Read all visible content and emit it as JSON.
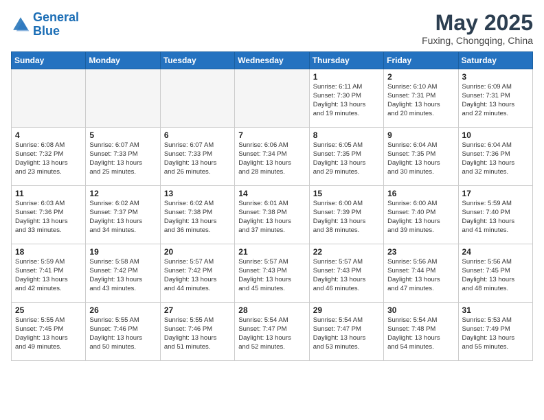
{
  "logo": {
    "line1": "General",
    "line2": "Blue"
  },
  "title": "May 2025",
  "subtitle": "Fuxing, Chongqing, China",
  "days_of_week": [
    "Sunday",
    "Monday",
    "Tuesday",
    "Wednesday",
    "Thursday",
    "Friday",
    "Saturday"
  ],
  "weeks": [
    [
      {
        "day": "",
        "info": ""
      },
      {
        "day": "",
        "info": ""
      },
      {
        "day": "",
        "info": ""
      },
      {
        "day": "",
        "info": ""
      },
      {
        "day": "1",
        "info": "Sunrise: 6:11 AM\nSunset: 7:30 PM\nDaylight: 13 hours\nand 19 minutes."
      },
      {
        "day": "2",
        "info": "Sunrise: 6:10 AM\nSunset: 7:31 PM\nDaylight: 13 hours\nand 20 minutes."
      },
      {
        "day": "3",
        "info": "Sunrise: 6:09 AM\nSunset: 7:31 PM\nDaylight: 13 hours\nand 22 minutes."
      }
    ],
    [
      {
        "day": "4",
        "info": "Sunrise: 6:08 AM\nSunset: 7:32 PM\nDaylight: 13 hours\nand 23 minutes."
      },
      {
        "day": "5",
        "info": "Sunrise: 6:07 AM\nSunset: 7:33 PM\nDaylight: 13 hours\nand 25 minutes."
      },
      {
        "day": "6",
        "info": "Sunrise: 6:07 AM\nSunset: 7:33 PM\nDaylight: 13 hours\nand 26 minutes."
      },
      {
        "day": "7",
        "info": "Sunrise: 6:06 AM\nSunset: 7:34 PM\nDaylight: 13 hours\nand 28 minutes."
      },
      {
        "day": "8",
        "info": "Sunrise: 6:05 AM\nSunset: 7:35 PM\nDaylight: 13 hours\nand 29 minutes."
      },
      {
        "day": "9",
        "info": "Sunrise: 6:04 AM\nSunset: 7:35 PM\nDaylight: 13 hours\nand 30 minutes."
      },
      {
        "day": "10",
        "info": "Sunrise: 6:04 AM\nSunset: 7:36 PM\nDaylight: 13 hours\nand 32 minutes."
      }
    ],
    [
      {
        "day": "11",
        "info": "Sunrise: 6:03 AM\nSunset: 7:36 PM\nDaylight: 13 hours\nand 33 minutes."
      },
      {
        "day": "12",
        "info": "Sunrise: 6:02 AM\nSunset: 7:37 PM\nDaylight: 13 hours\nand 34 minutes."
      },
      {
        "day": "13",
        "info": "Sunrise: 6:02 AM\nSunset: 7:38 PM\nDaylight: 13 hours\nand 36 minutes."
      },
      {
        "day": "14",
        "info": "Sunrise: 6:01 AM\nSunset: 7:38 PM\nDaylight: 13 hours\nand 37 minutes."
      },
      {
        "day": "15",
        "info": "Sunrise: 6:00 AM\nSunset: 7:39 PM\nDaylight: 13 hours\nand 38 minutes."
      },
      {
        "day": "16",
        "info": "Sunrise: 6:00 AM\nSunset: 7:40 PM\nDaylight: 13 hours\nand 39 minutes."
      },
      {
        "day": "17",
        "info": "Sunrise: 5:59 AM\nSunset: 7:40 PM\nDaylight: 13 hours\nand 41 minutes."
      }
    ],
    [
      {
        "day": "18",
        "info": "Sunrise: 5:59 AM\nSunset: 7:41 PM\nDaylight: 13 hours\nand 42 minutes."
      },
      {
        "day": "19",
        "info": "Sunrise: 5:58 AM\nSunset: 7:42 PM\nDaylight: 13 hours\nand 43 minutes."
      },
      {
        "day": "20",
        "info": "Sunrise: 5:57 AM\nSunset: 7:42 PM\nDaylight: 13 hours\nand 44 minutes."
      },
      {
        "day": "21",
        "info": "Sunrise: 5:57 AM\nSunset: 7:43 PM\nDaylight: 13 hours\nand 45 minutes."
      },
      {
        "day": "22",
        "info": "Sunrise: 5:57 AM\nSunset: 7:43 PM\nDaylight: 13 hours\nand 46 minutes."
      },
      {
        "day": "23",
        "info": "Sunrise: 5:56 AM\nSunset: 7:44 PM\nDaylight: 13 hours\nand 47 minutes."
      },
      {
        "day": "24",
        "info": "Sunrise: 5:56 AM\nSunset: 7:45 PM\nDaylight: 13 hours\nand 48 minutes."
      }
    ],
    [
      {
        "day": "25",
        "info": "Sunrise: 5:55 AM\nSunset: 7:45 PM\nDaylight: 13 hours\nand 49 minutes."
      },
      {
        "day": "26",
        "info": "Sunrise: 5:55 AM\nSunset: 7:46 PM\nDaylight: 13 hours\nand 50 minutes."
      },
      {
        "day": "27",
        "info": "Sunrise: 5:55 AM\nSunset: 7:46 PM\nDaylight: 13 hours\nand 51 minutes."
      },
      {
        "day": "28",
        "info": "Sunrise: 5:54 AM\nSunset: 7:47 PM\nDaylight: 13 hours\nand 52 minutes."
      },
      {
        "day": "29",
        "info": "Sunrise: 5:54 AM\nSunset: 7:47 PM\nDaylight: 13 hours\nand 53 minutes."
      },
      {
        "day": "30",
        "info": "Sunrise: 5:54 AM\nSunset: 7:48 PM\nDaylight: 13 hours\nand 54 minutes."
      },
      {
        "day": "31",
        "info": "Sunrise: 5:53 AM\nSunset: 7:49 PM\nDaylight: 13 hours\nand 55 minutes."
      }
    ]
  ]
}
